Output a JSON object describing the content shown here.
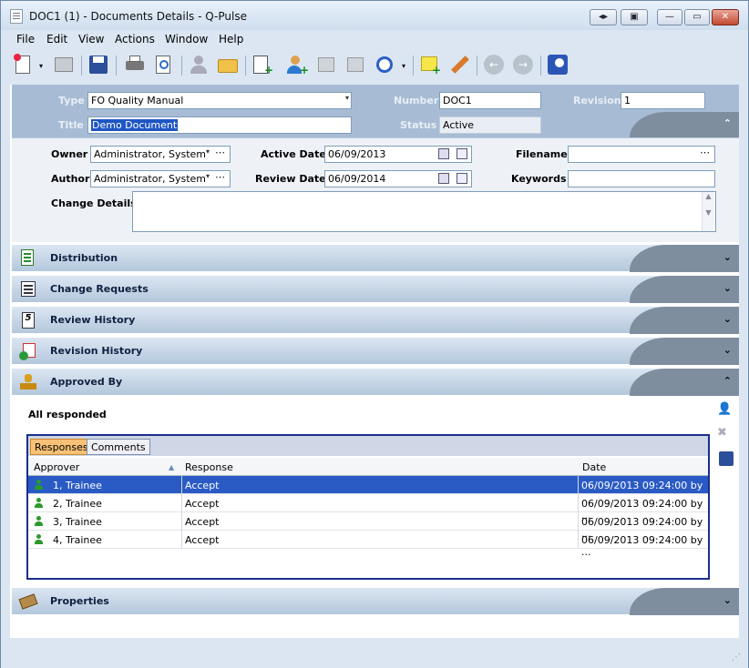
{
  "window": {
    "title": "DOC1 (1) - Documents Details - Q-Pulse"
  },
  "menu": [
    "File",
    "Edit",
    "View",
    "Actions",
    "Window",
    "Help"
  ],
  "header": {
    "type_label": "Type",
    "type_value": "FO Quality Manual",
    "number_label": "Number",
    "number_value": "DOC1",
    "revision_label": "Revision",
    "revision_value": "1",
    "title_label": "Title",
    "title_value": "Demo Document",
    "status_label": "Status",
    "status_value": "Active"
  },
  "general": {
    "owner_label": "Owner",
    "owner_value": "Administrator, System",
    "author_label": "Author",
    "author_value": "Administrator, System",
    "active_date_label": "Active Date",
    "active_date_value": "06/09/2013",
    "review_date_label": "Review Date",
    "review_date_value": "06/09/2014",
    "filename_label": "Filename",
    "filename_value": "",
    "keywords_label": "Keywords",
    "keywords_value": "",
    "change_details_label": "Change Details",
    "change_details_value": ""
  },
  "sections": [
    "Distribution",
    "Change Requests",
    "Review History",
    "Revision History",
    "Approved By",
    "Properties"
  ],
  "approved": {
    "summary": "All responded",
    "tabs": [
      "Responses",
      "Comments"
    ],
    "columns": [
      "Approver",
      "Response",
      "Date"
    ],
    "rows": [
      {
        "approver": "1, Trainee",
        "response": "Accept",
        "date": "06/09/2013 09:24:00 by ..."
      },
      {
        "approver": "2, Trainee",
        "response": "Accept",
        "date": "06/09/2013 09:24:00 by ..."
      },
      {
        "approver": "3, Trainee",
        "response": "Accept",
        "date": "06/09/2013 09:24:00 by ..."
      },
      {
        "approver": "4, Trainee",
        "response": "Accept",
        "date": "06/09/2013 09:24:00 by ..."
      }
    ]
  }
}
